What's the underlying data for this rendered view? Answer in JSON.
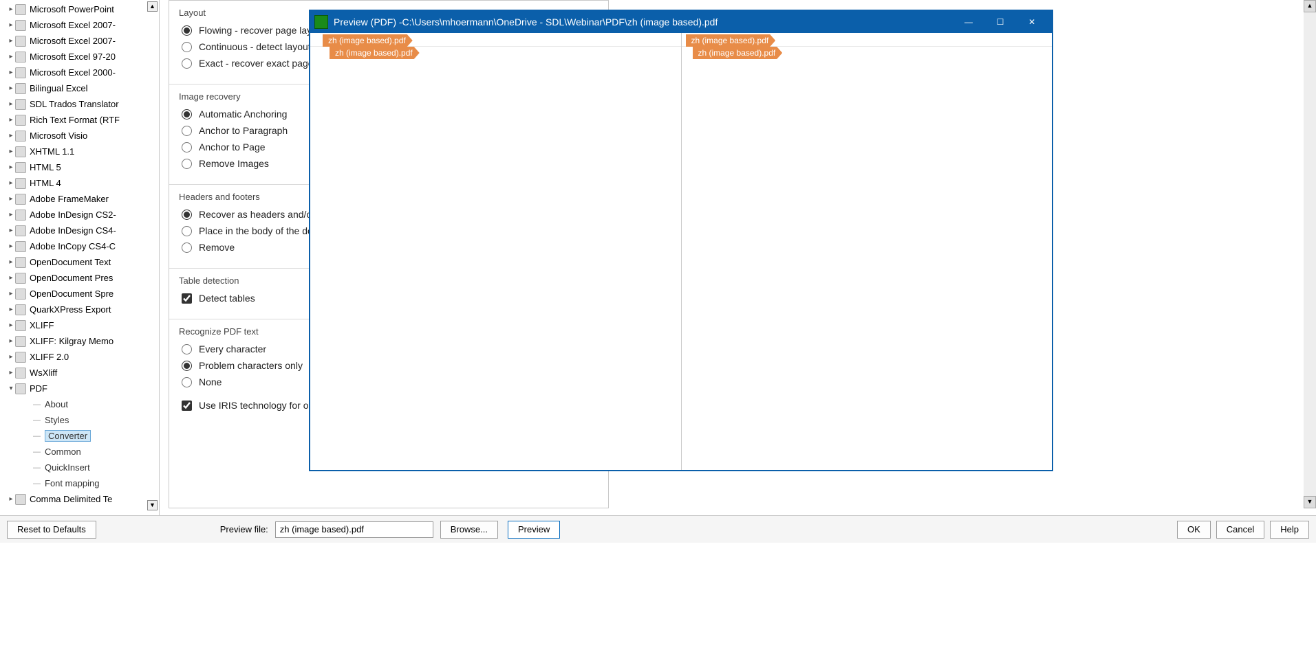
{
  "tree": [
    {
      "label": "Microsoft PowerPoint",
      "iconcls": "ic-orange"
    },
    {
      "label": "Microsoft Excel 2007-",
      "iconcls": "ic-green"
    },
    {
      "label": "Microsoft Excel 2007-",
      "iconcls": "ic-green"
    },
    {
      "label": "Microsoft Excel 97-20",
      "iconcls": "ic-green"
    },
    {
      "label": "Microsoft Excel 2000-",
      "iconcls": "ic-green"
    },
    {
      "label": "Bilingual Excel",
      "iconcls": "ic-green"
    },
    {
      "label": "SDL Trados Translator",
      "iconcls": "ic-blue"
    },
    {
      "label": "Rich Text Format (RTF",
      "iconcls": "ic-blue"
    },
    {
      "label": "Microsoft Visio",
      "iconcls": "ic-blue"
    },
    {
      "label": "XHTML 1.1",
      "iconcls": "ic-blue"
    },
    {
      "label": "HTML 5",
      "iconcls": "ic-orange"
    },
    {
      "label": "HTML 4",
      "iconcls": "ic-blue"
    },
    {
      "label": "Adobe FrameMaker",
      "iconcls": "ic-brown"
    },
    {
      "label": "Adobe InDesign CS2-",
      "iconcls": "ic-purple"
    },
    {
      "label": "Adobe InDesign CS4-",
      "iconcls": "ic-purple"
    },
    {
      "label": "Adobe InCopy CS4-C",
      "iconcls": "ic-purple"
    },
    {
      "label": "OpenDocument Text",
      "iconcls": "ic-teal"
    },
    {
      "label": "OpenDocument Pres",
      "iconcls": "ic-teal"
    },
    {
      "label": "OpenDocument Spre",
      "iconcls": "ic-teal"
    },
    {
      "label": "QuarkXPress Export",
      "iconcls": "ic-orange"
    },
    {
      "label": "XLIFF",
      "iconcls": "ic-gray"
    },
    {
      "label": "XLIFF: Kilgray Memo",
      "iconcls": "ic-gray"
    },
    {
      "label": "XLIFF 2.0",
      "iconcls": "ic-gray"
    },
    {
      "label": "WsXliff",
      "iconcls": "ic-teal"
    },
    {
      "label": "PDF",
      "iconcls": "ic-red",
      "expanded": true,
      "children": [
        {
          "label": "About"
        },
        {
          "label": "Styles"
        },
        {
          "label": "Converter",
          "selected": true
        },
        {
          "label": "Common"
        },
        {
          "label": "QuickInsert"
        },
        {
          "label": "Font mapping"
        }
      ]
    },
    {
      "label": "Comma Delimited Te",
      "iconcls": "ic-green"
    }
  ],
  "settings": {
    "layout": {
      "title": "Layout",
      "opts": [
        {
          "label": "Flowing - recover page layo",
          "checked": true
        },
        {
          "label": "Continuous - detect layout",
          "checked": false
        },
        {
          "label": "Exact - recover exact page ",
          "checked": false
        }
      ]
    },
    "imageRecovery": {
      "title": "Image recovery",
      "opts": [
        {
          "label": "Automatic Anchoring",
          "checked": true
        },
        {
          "label": "Anchor to Paragraph",
          "checked": false
        },
        {
          "label": "Anchor to Page",
          "checked": false
        },
        {
          "label": "Remove Images",
          "checked": false
        }
      ]
    },
    "headersFooters": {
      "title": "Headers and footers",
      "opts": [
        {
          "label": "Recover as headers and/or",
          "checked": true
        },
        {
          "label": "Place in the body of the do",
          "checked": false
        },
        {
          "label": "Remove",
          "checked": false
        }
      ]
    },
    "tableDetection": {
      "title": "Table detection",
      "check": {
        "label": "Detect tables",
        "checked": true
      }
    },
    "recognize": {
      "title": "Recognize PDF text",
      "opts": [
        {
          "label": "Every character",
          "checked": false
        },
        {
          "label": "Problem characters only",
          "checked": true
        },
        {
          "label": "None",
          "checked": false
        }
      ],
      "iris": {
        "label": "Use IRIS technology for optical character recognition",
        "checked": true
      }
    }
  },
  "preview": {
    "title": "Preview (PDF) -C:\\Users\\mhoermann\\OneDrive - SDL\\Webinar\\PDF\\zh (image based).pdf",
    "tabOuter": "zh (image based).pdf",
    "tabInner": "zh (image based).pdf"
  },
  "bottom": {
    "reset": "Reset to Defaults",
    "previewFileLabel": "Preview file:",
    "previewFileValue": "zh (image based).pdf",
    "browse": "Browse...",
    "previewBtn": "Preview",
    "ok": "OK",
    "cancel": "Cancel",
    "help": "Help"
  }
}
